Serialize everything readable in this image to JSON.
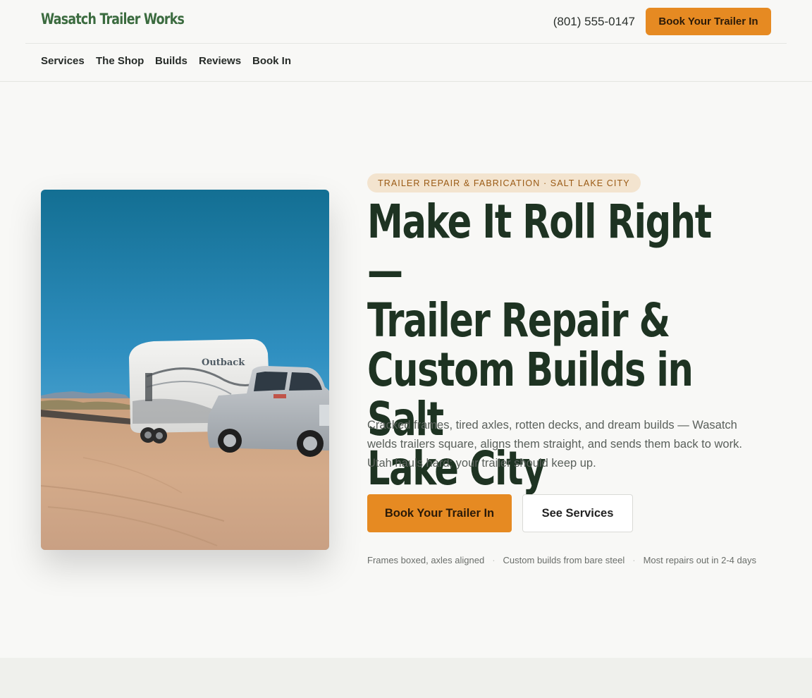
{
  "header": {
    "logo": "Wasatch Trailer Works",
    "phone": "(801) 555-0147",
    "cta_label": "Book Your Trailer In"
  },
  "nav": {
    "items": [
      "Services",
      "The Shop",
      "Builds",
      "Reviews",
      "Book In"
    ]
  },
  "hero": {
    "eyebrow": "TRAILER REPAIR & FABRICATION · SALT LAKE CITY",
    "headline_lines": [
      "Make It Roll Right —",
      "Trailer Repair &",
      "Custom Builds in Salt",
      "Lake City"
    ],
    "lede": "Cracked frames, tired axles, rotten decks, and dream builds — Wasatch welds trailers square, aligns them straight, and sends them back to work. Utah hauls hard; your trailer should keep up.",
    "primary_cta": "Book Your Trailer In",
    "secondary_cta": "See Services",
    "trust_points": [
      "Frames boxed, axles aligned",
      "Custom builds from bare steel",
      "Most repairs out in 2-4 days"
    ],
    "image": {
      "trailer_badge": "Outback"
    }
  },
  "colors": {
    "accent": "#e68a22",
    "brand_green": "#3b6b3f",
    "headline": "#1e3322",
    "eyebrow_bg": "#f3e4cf",
    "eyebrow_text": "#9a5a14",
    "page_bg": "#f8f8f6"
  }
}
